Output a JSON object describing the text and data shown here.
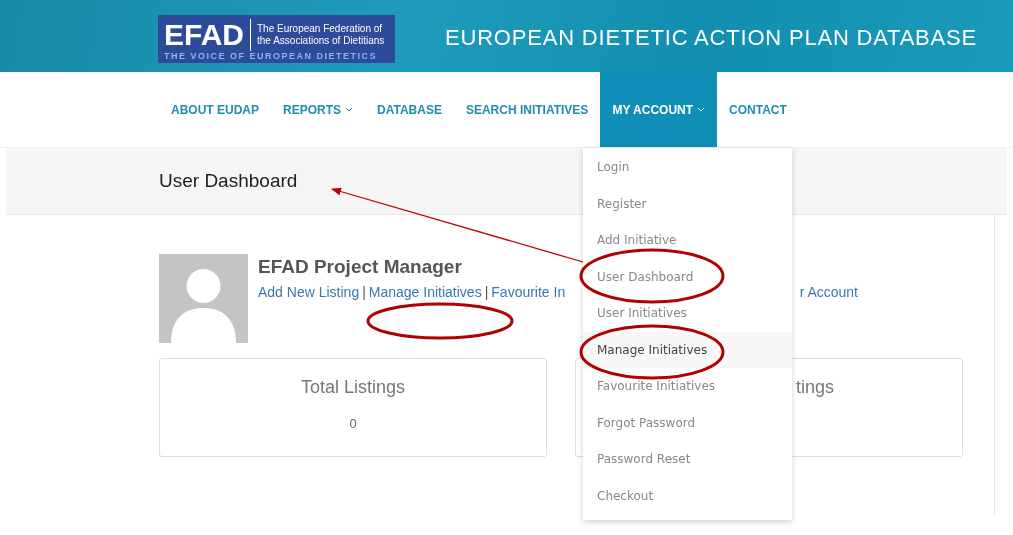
{
  "header": {
    "logo": {
      "mark": "EFAD",
      "name_line_1": "The European Federation of",
      "name_line_2": "the Associations of Dietitians",
      "tagline": "THE VOICE OF EUROPEAN DIETETICS"
    },
    "site_title": "EUROPEAN DIETETIC ACTION PLAN DATABASE"
  },
  "nav": [
    {
      "label": "ABOUT EUDAP",
      "selected": false,
      "has_submenu": false
    },
    {
      "label": "REPORTS",
      "selected": false,
      "has_submenu": true
    },
    {
      "label": "DATABASE",
      "selected": false,
      "has_submenu": false
    },
    {
      "label": "SEARCH INITIATIVES",
      "selected": false,
      "has_submenu": false
    },
    {
      "label": "MY ACCOUNT",
      "selected": true,
      "has_submenu": true
    },
    {
      "label": "CONTACT",
      "selected": false,
      "has_submenu": false
    }
  ],
  "page_title": "User Dashboard",
  "profile": {
    "name": "EFAD Project Manager",
    "links": [
      "Add New Listing",
      "Manage Initiatives",
      "Favourite In"
    ],
    "separator": "|",
    "links_right": "r Account"
  },
  "cards": [
    {
      "title": "Total Listings",
      "value": "0"
    },
    {
      "title": "tings"
    }
  ],
  "dropdown": [
    {
      "label": "Login",
      "selected": false
    },
    {
      "label": "Register",
      "selected": false
    },
    {
      "label": "Add Initiative",
      "selected": false
    },
    {
      "label": "User Dashboard",
      "selected": false
    },
    {
      "label": "User Initiatives",
      "selected": false
    },
    {
      "label": "Manage Initiatives",
      "selected": true
    },
    {
      "label": "Favourite Initiatives",
      "selected": false
    },
    {
      "label": "Forgot Password",
      "selected": false
    },
    {
      "label": "Password Reset",
      "selected": false
    },
    {
      "label": "Checkout",
      "selected": false
    }
  ]
}
